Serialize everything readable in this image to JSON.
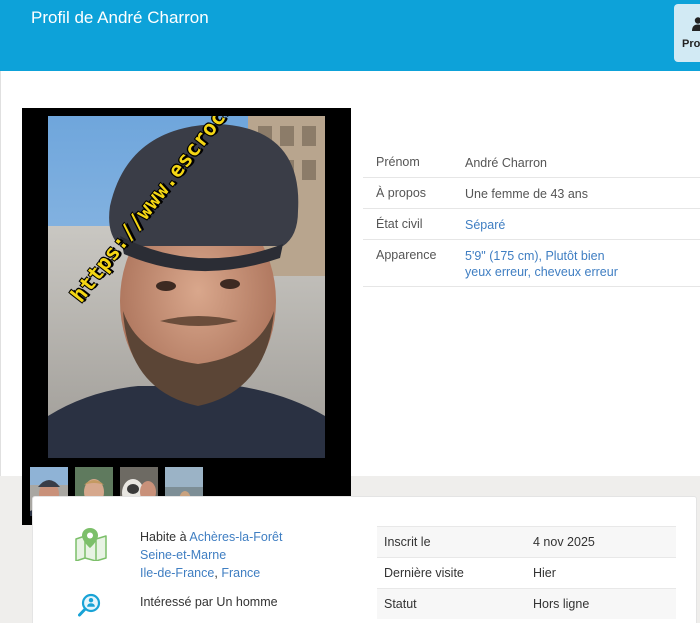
{
  "header": {
    "title": "Profil de André Charron",
    "tab_label": "Pro",
    "tab_icon": "user-icon",
    "bg_color": "#0da2d9"
  },
  "photos": {
    "watermark": "https://www.escrocs-du-web.fr",
    "thumbnail_count": 4
  },
  "profile": {
    "rows": [
      {
        "label": "Prénom",
        "value": "André Charron"
      },
      {
        "label": "À propos",
        "value": "Une femme de 43 ans"
      },
      {
        "label": "État civil",
        "value": "Séparé"
      },
      {
        "label": "Apparence",
        "value_line1": "5'9\" (175 cm), Plutôt bien",
        "value_line2": "yeux erreur, cheveux erreur"
      }
    ],
    "link_color": "#3f7ec2"
  },
  "location": {
    "prefix": "Habite à",
    "city": "Achères-la-Forêt",
    "department": "Seine-et-Marne",
    "region": "Ile-de-France",
    "separator": ",",
    "country": "France",
    "icon": "map-icon"
  },
  "interest": {
    "text": "Intéressé par Un homme",
    "icon": "search-person-icon"
  },
  "stats": [
    {
      "label": "Inscrit le",
      "value": "4 nov 2025"
    },
    {
      "label": "Dernière visite",
      "value": "Hier"
    },
    {
      "label": "Statut",
      "value": "Hors ligne"
    }
  ]
}
